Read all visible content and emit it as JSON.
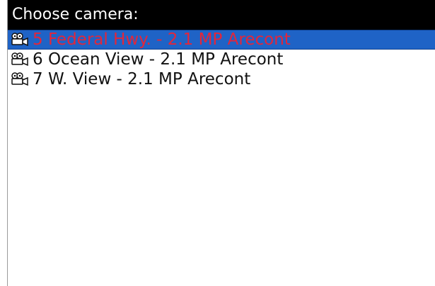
{
  "title": "Choose camera:",
  "cameras": [
    {
      "label": "5 Federal Hwy. - 2.1 MP Arecont",
      "selected": true,
      "icon": "video-camera-icon"
    },
    {
      "label": "6 Ocean View - 2.1 MP Arecont",
      "selected": false,
      "icon": "video-camera-icon"
    },
    {
      "label": "7 W. View - 2.1 MP Arecont",
      "selected": false,
      "icon": "video-camera-icon"
    }
  ],
  "colors": {
    "title_bar_bg": "#000000",
    "title_text": "#ffffff",
    "selected_bg": "#1f63c6",
    "selected_text": "#e3263a",
    "item_text": "#111111"
  }
}
